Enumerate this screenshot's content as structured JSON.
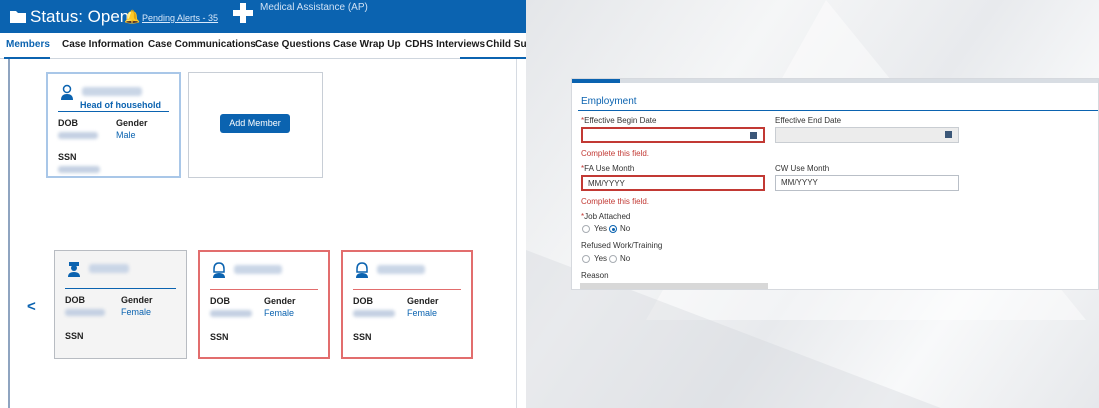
{
  "header": {
    "status": "Status:  Open",
    "alerts_link": "Pending Alerts - 35",
    "program": "Medical Assistance (AP)"
  },
  "tabs": [
    "Members",
    "Case Information",
    "Case Communications",
    "Case Questions",
    "Case Wrap Up",
    "CDHS Interviews",
    "Child Sup"
  ],
  "members": {
    "head": {
      "role": "Head of household",
      "dob_label": "DOB",
      "gender_label": "Gender",
      "gender": "Male",
      "ssn_label": "SSN"
    },
    "add_member_label": "Add Member",
    "prev_label": "<",
    "others": [
      {
        "dob_label": "DOB",
        "gender_label": "Gender",
        "gender": "Female",
        "ssn_label": "SSN"
      },
      {
        "dob_label": "DOB",
        "gender_label": "Gender",
        "gender": "Female",
        "ssn_label": "SSN"
      },
      {
        "dob_label": "DOB",
        "gender_label": "Gender",
        "gender": "Female",
        "ssn_label": "SSN"
      }
    ]
  },
  "form": {
    "title": "Employment",
    "effective_begin_label": "Effective Begin Date",
    "effective_end_label": "Effective End Date",
    "error_text": "Complete this field.",
    "fa_use_month_label": "FA Use Month",
    "fa_use_month_placeholder": "MM/YYYY",
    "cw_use_month_label": "CW Use Month",
    "cw_use_month_placeholder": "MM/YYYY",
    "job_attached_label": "Job Attached",
    "refused_label": "Refused Work/Training",
    "yes_label": "Yes",
    "no_label": "No",
    "reason_label": "Reason",
    "required_marker": "*"
  },
  "colors": {
    "brand": "#0b63b0",
    "error": "#c23934"
  }
}
